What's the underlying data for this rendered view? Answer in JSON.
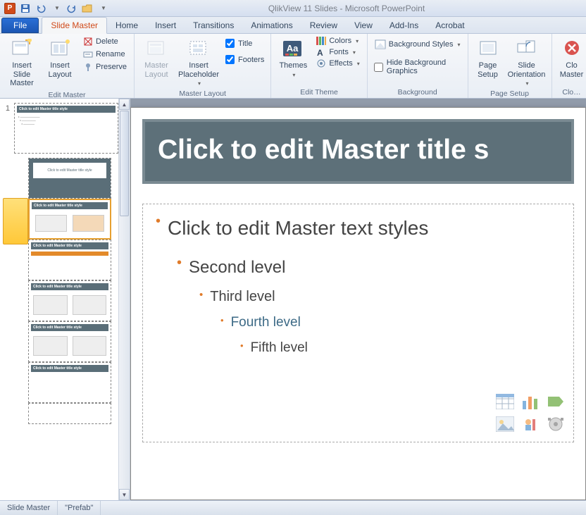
{
  "app": {
    "title": "QlikView 11 Slides  -  Microsoft PowerPoint",
    "badge": "P"
  },
  "qat": {
    "save": "save-icon",
    "undo": "undo-icon",
    "redo": "redo-icon",
    "open": "open-icon"
  },
  "tabs": {
    "file": "File",
    "slide_master": "Slide Master",
    "home": "Home",
    "insert": "Insert",
    "transitions": "Transitions",
    "animations": "Animations",
    "review": "Review",
    "view": "View",
    "addins": "Add-Ins",
    "acrobat": "Acrobat"
  },
  "ribbon": {
    "edit_master": {
      "title": "Edit Master",
      "insert_slide_master": "Insert Slide Master",
      "insert_layout": "Insert Layout",
      "delete": "Delete",
      "rename": "Rename",
      "preserve": "Preserve"
    },
    "master_layout": {
      "title": "Master Layout",
      "master_layout_btn": "Master Layout",
      "insert_placeholder": "Insert Placeholder",
      "chk_title": "Title",
      "chk_footers": "Footers"
    },
    "edit_theme": {
      "title": "Edit Theme",
      "themes": "Themes",
      "colors": "Colors",
      "fonts": "Fonts",
      "effects": "Effects"
    },
    "background": {
      "title": "Background",
      "styles": "Background Styles",
      "hide": "Hide Background Graphics"
    },
    "page_setup": {
      "title": "Page Setup",
      "page_setup_btn": "Page Setup",
      "orientation": "Slide Orientation"
    },
    "close": {
      "title": "Clo…",
      "btn": "Clo Master"
    }
  },
  "thumbs": {
    "num": "1",
    "labels": {
      "master": "Click to edit Master title style",
      "layout_generic": "Click to edit Master title style"
    }
  },
  "slide": {
    "title": "Click to edit Master title s",
    "l1": "Click to edit Master text styles",
    "l2": "Second level",
    "l3": "Third level",
    "l4": "Fourth level",
    "l5": "Fifth level"
  },
  "status": {
    "left": "Slide Master",
    "layout": "\"Prefab\""
  },
  "colors": {
    "accent": "#e07b2a",
    "title_bg": "#5d7079",
    "ribbon_text": "#33475f"
  }
}
